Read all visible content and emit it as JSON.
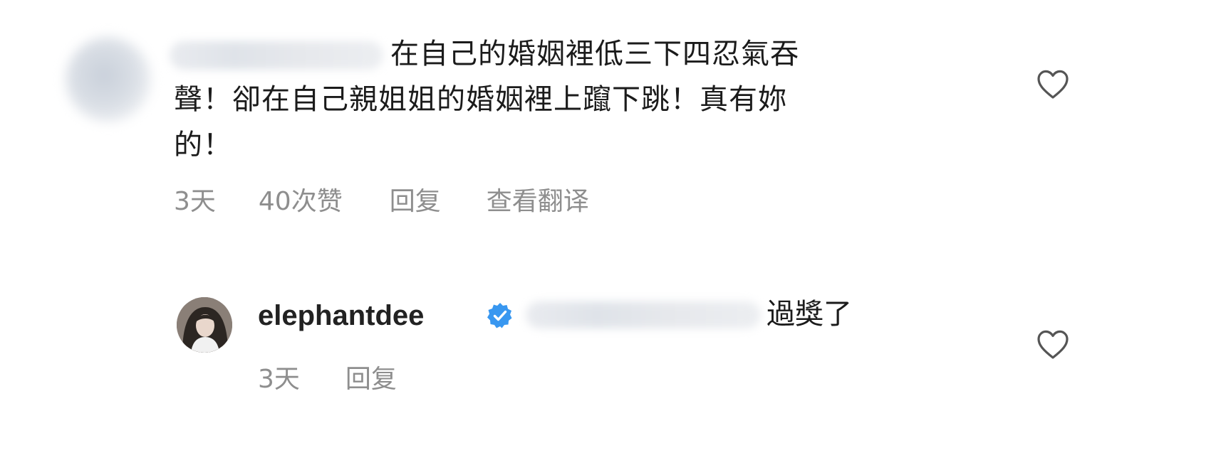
{
  "comments": [
    {
      "text": "在自己的婚姻裡低三下四忍氣吞聲！卻在自己親姐姐的婚姻裡上躥下跳！真有妳的！",
      "line1": "在自己的婚姻裡低三下四忍氣吞",
      "line2": "聲！卻在自己親姐姐的婚姻裡上躥下跳！真有妳",
      "line3": "的！",
      "time": "3天",
      "likes": "40次赞",
      "reply_label": "回复",
      "translate_label": "查看翻译",
      "like_icon": "heart-outline-icon"
    },
    {
      "username": "elephantdee",
      "verified_icon": "verified-badge-icon",
      "text": "過獎了",
      "time": "3天",
      "reply_label": "回复",
      "like_icon": "heart-outline-icon"
    }
  ],
  "colors": {
    "text": "#1b1b1b",
    "meta": "#8e8e8e",
    "verified": "#3897f0",
    "icon_stroke": "#555555"
  }
}
